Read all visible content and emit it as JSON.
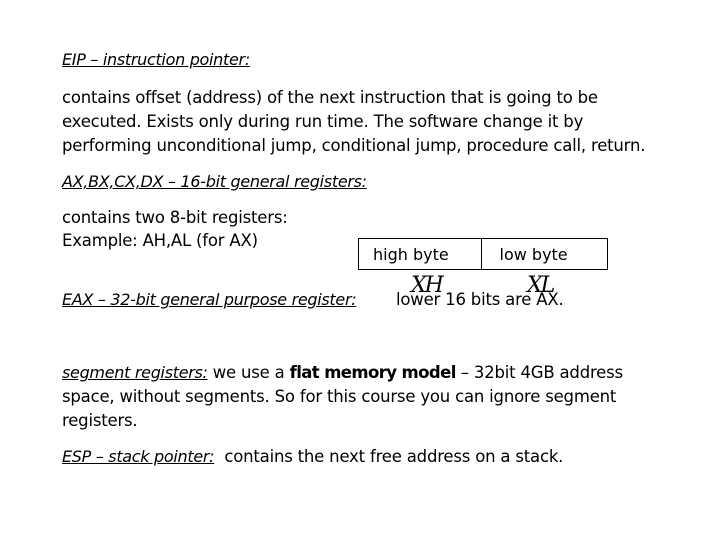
{
  "eip": {
    "heading": "EIP – instruction pointer:",
    "lines": [
      "contains offset (address) of the next instruction that is going to be",
      "executed. Exists only during run time. The software change it by",
      "performing unconditional jump, conditional jump, procedure call, return."
    ]
  },
  "general_registers": {
    "heading": "AX,BX,CX,DX – 16-bit general registers:",
    "lines": [
      "contains two 8-bit registers:",
      "Example: AH,AL (for AX)"
    ],
    "byte_table": {
      "high": "high byte",
      "low": "low byte"
    }
  },
  "eax": {
    "heading": "EAX – 32-bit general purpose register:",
    "text": "lower 16 bits are AX.",
    "overlay_labels": [
      "XH",
      "XL"
    ]
  },
  "segment": {
    "heading": "segment registers:",
    "text_before": " we use a ",
    "bold": "flat memory model",
    "text_after": " – 32bit 4GB address",
    "lines": [
      "space, without segments. So for this course you can ignore segment",
      "registers."
    ]
  },
  "esp": {
    "heading": "ESP – stack pointer:",
    "text": "  contains the next free address on a stack."
  }
}
